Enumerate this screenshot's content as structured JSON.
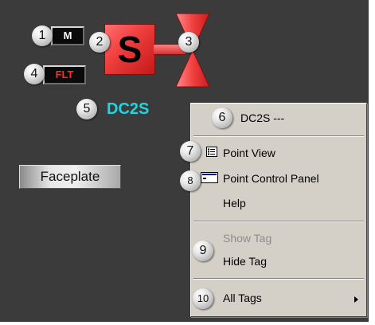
{
  "callouts": [
    "1",
    "2",
    "3",
    "4",
    "5",
    "6",
    "7",
    "8",
    "9",
    "10"
  ],
  "mode_box": {
    "label": "M",
    "color": "#ffffff"
  },
  "fault_box": {
    "label": "FLT",
    "color": "#ff2a2a"
  },
  "valve": {
    "letter": "S",
    "color": "#f04040"
  },
  "tag_name": "DC2S",
  "faceplate_button": "Faceplate",
  "context_menu": {
    "title": "DC2S ---",
    "items": {
      "point_view": "Point View",
      "point_control_panel": "Point Control Panel",
      "help": "Help",
      "show_tag": "Show Tag",
      "hide_tag": "Hide Tag",
      "all_tags": "All Tags"
    },
    "show_tag_disabled": true,
    "icons": {
      "point_view": "list-view-icon",
      "point_control_panel": "control-panel-icon",
      "all_tags": "submenu-arrow-icon"
    }
  }
}
